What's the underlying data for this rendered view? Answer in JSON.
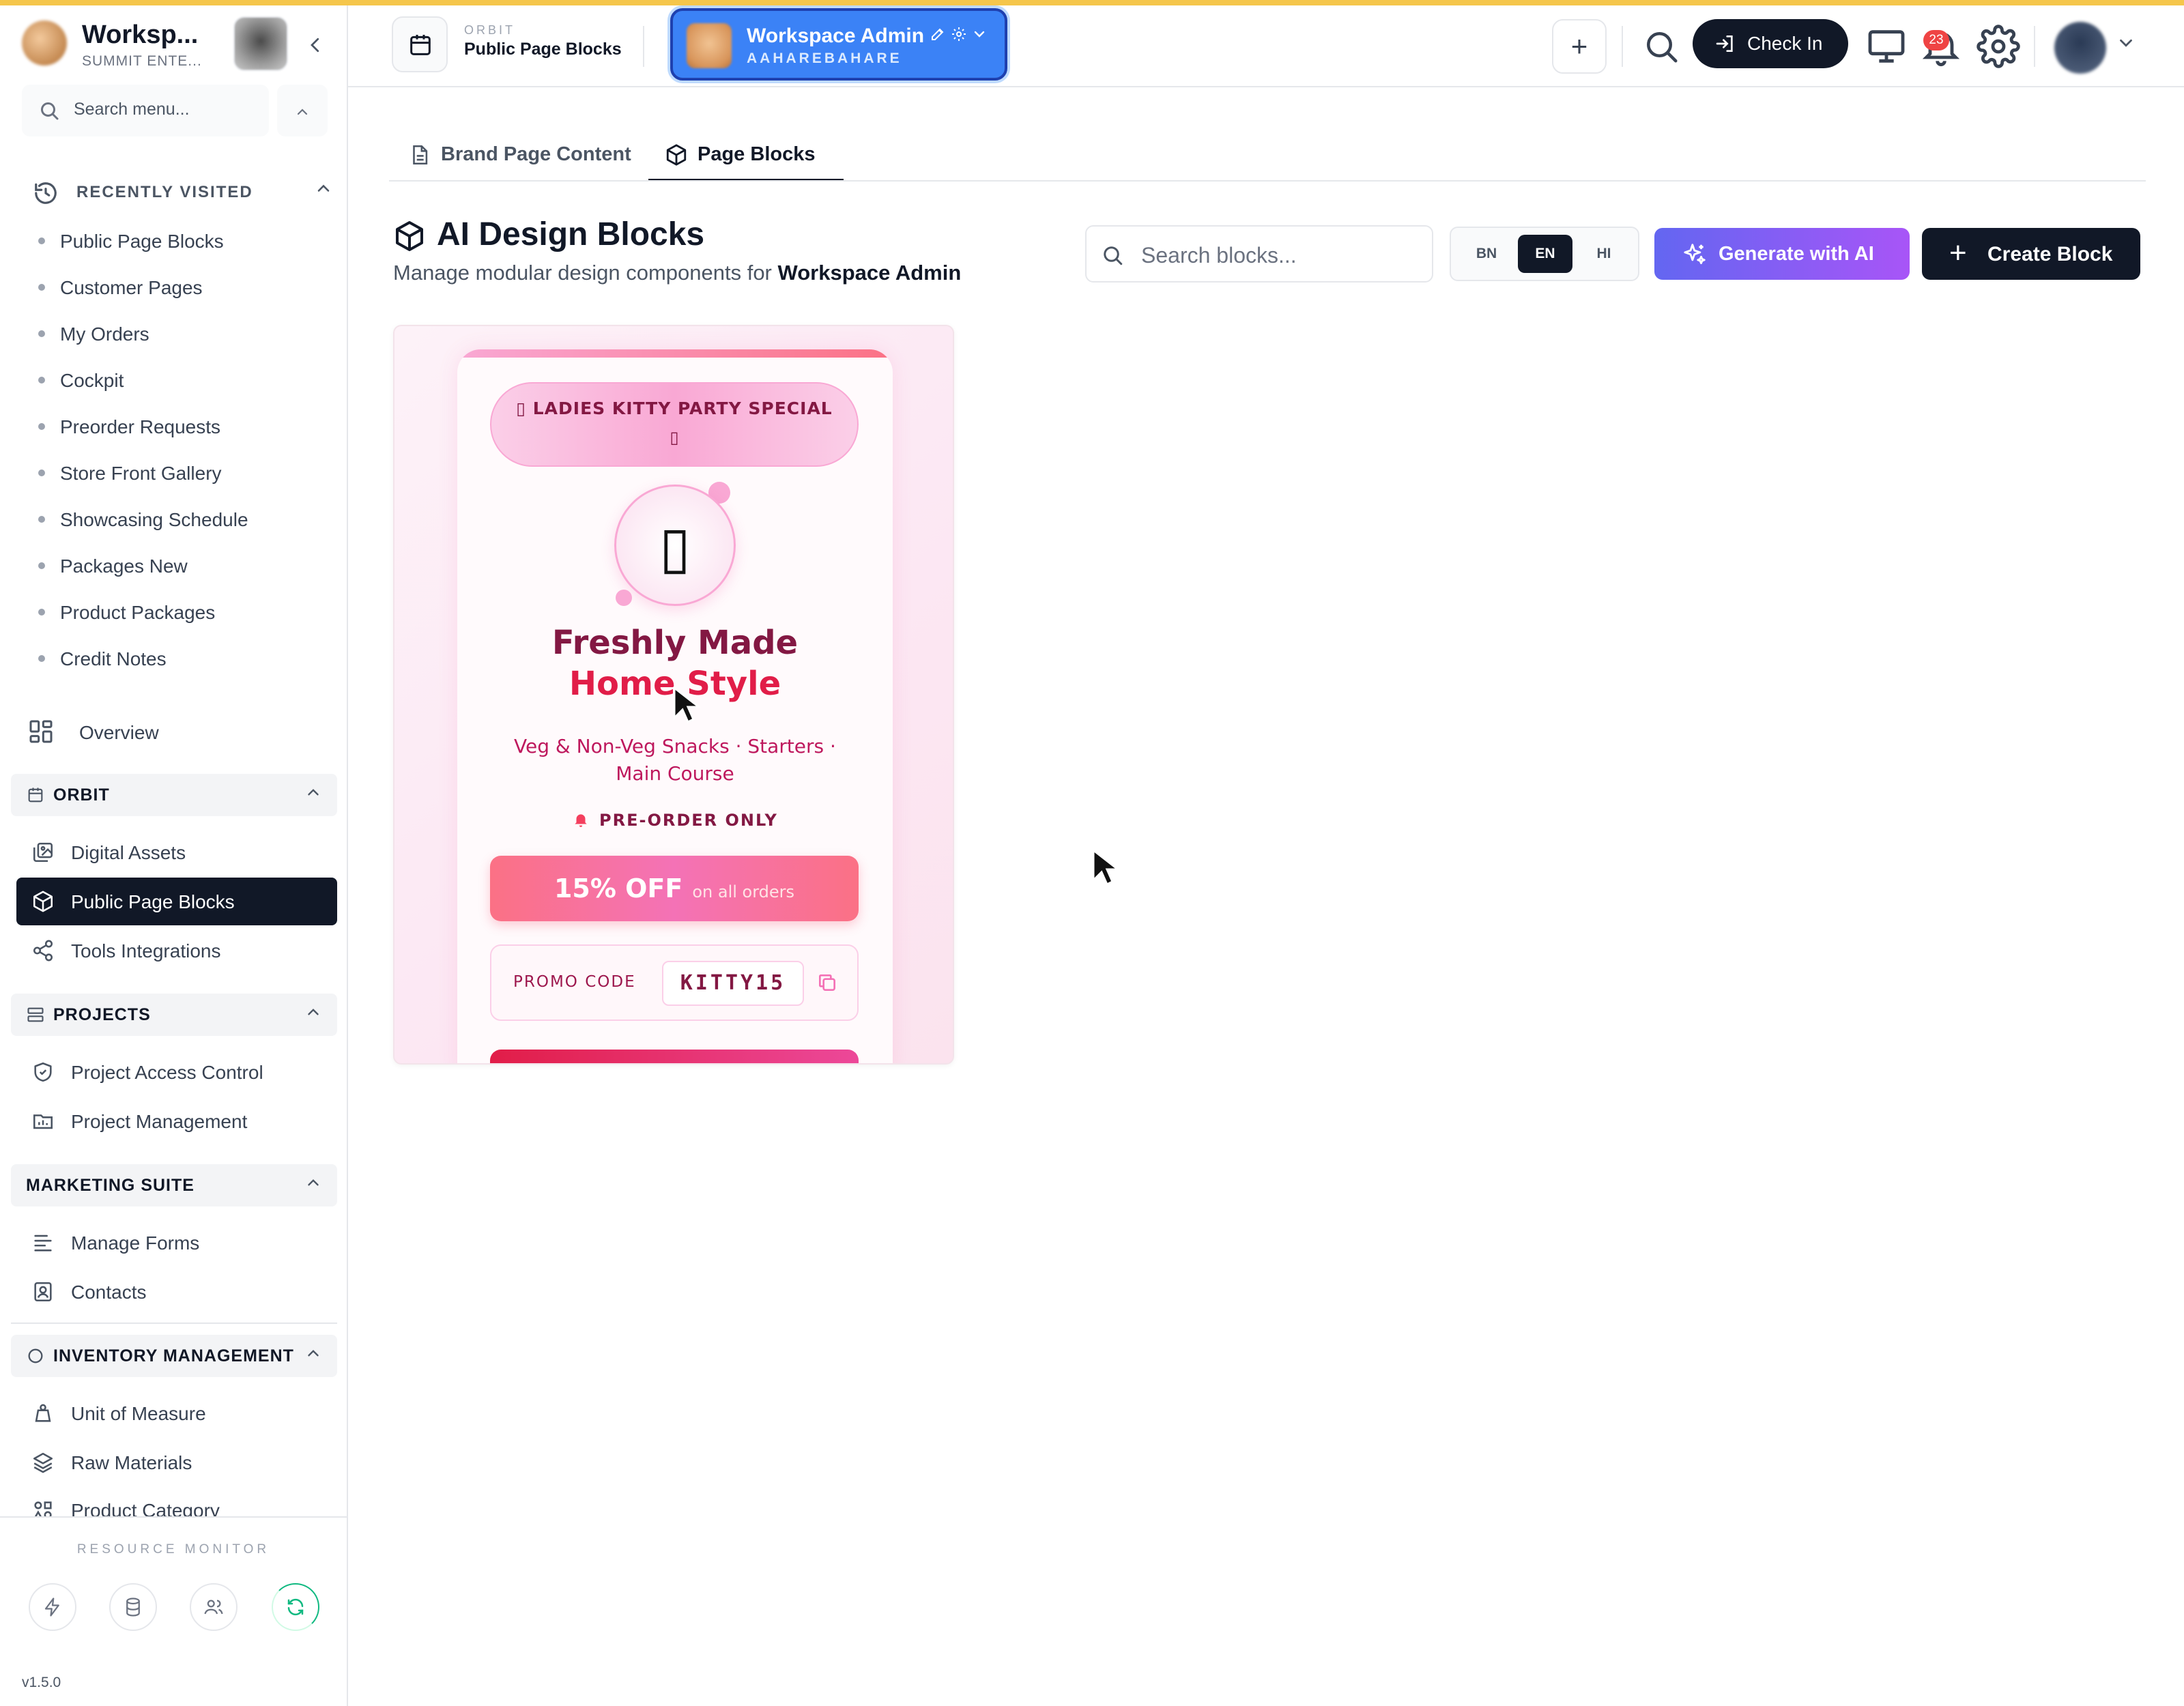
{
  "sidebar": {
    "brand_name": "Worksp...",
    "brand_sub": "SUMMIT ENTE...",
    "search_placeholder": "Search menu...",
    "recent_title": "RECENTLY VISITED",
    "recent": [
      "Public Page Blocks",
      "Customer Pages",
      "My Orders",
      "Cockpit",
      "Preorder Requests",
      "Store Front Gallery",
      "Showcasing Schedule",
      "Packages New",
      "Product Packages",
      "Credit Notes"
    ],
    "overview": "Overview",
    "groups": {
      "orbit": {
        "title": "ORBIT",
        "items": [
          "Digital Assets",
          "Public Page Blocks",
          "Tools Integrations"
        ]
      },
      "projects": {
        "title": "PROJECTS",
        "items": [
          "Project Access Control",
          "Project Management"
        ]
      },
      "marketing": {
        "title": "MARKETING SUITE",
        "items": [
          "Manage Forms",
          "Contacts"
        ]
      },
      "inventory": {
        "title": "INVENTORY MANAGEMENT",
        "items": [
          "Unit of Measure",
          "Raw Materials",
          "Product Category"
        ]
      }
    },
    "active_item": "Public Page Blocks",
    "resource_monitor": "RESOURCE MONITOR",
    "version": "v1.5.0"
  },
  "topbar": {
    "crumb_small": "ORBIT",
    "crumb_big": "Public Page Blocks",
    "workspace_name": "Workspace Admin",
    "workspace_code": "AAHAREBAHARE",
    "checkin_label": "Check In",
    "notification_count": "23"
  },
  "tabs": [
    "Brand Page Content",
    "Page Blocks"
  ],
  "active_tab": "Page Blocks",
  "page": {
    "title": "AI Design Blocks",
    "subtitle_prefix": "Manage modular design components for",
    "subtitle_strong": "Workspace Admin",
    "search_placeholder": "Search blocks...",
    "languages": [
      "BN",
      "EN",
      "HI"
    ],
    "selected_language": "EN",
    "generate_label": "Generate with AI",
    "create_label": "Create Block"
  },
  "block_preview": {
    "badge_line1": "▯ LADIES KITTY PARTY SPECIAL",
    "badge_line2": "▯",
    "emoji": "▯",
    "heading_line1": "Freshly Made",
    "heading_line2": "Home Style",
    "description": "Veg & Non-Veg Snacks · Starters · Main Course",
    "preorder": "PRE-ORDER ONLY",
    "discount": "15% OFF",
    "discount_sub": "on all orders",
    "promo_label": "PROMO CODE",
    "promo_code": "KITTY15"
  },
  "colors": {
    "accent_dark": "#111827",
    "workspace_blue": "#3b82f6",
    "ai_gradient_start": "#6366f1",
    "ai_gradient_end": "#a855f7",
    "notification_red": "#ef4444",
    "top_stripe": "#f5c64b"
  }
}
